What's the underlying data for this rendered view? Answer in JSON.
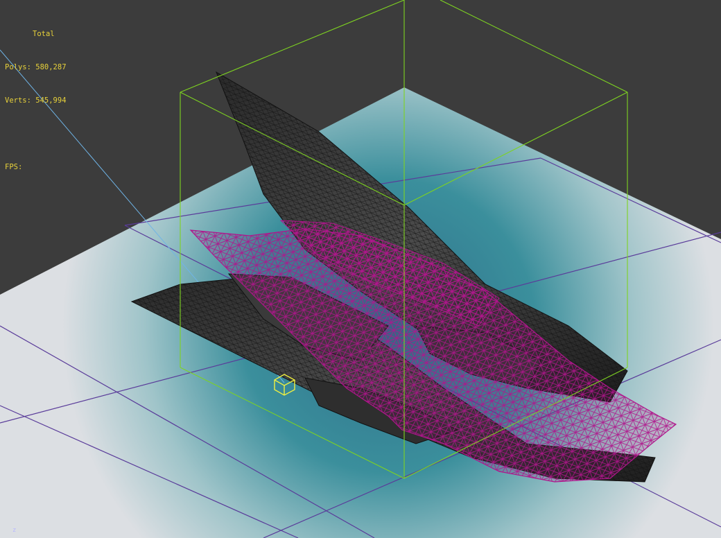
{
  "hud": {
    "total_label": "Total",
    "polys_label": "Polys:",
    "polys_value": "580,287",
    "verts_label": "Verts:",
    "verts_value": "545,994",
    "fps_label": "FPS:",
    "fps_value": ""
  },
  "viewport": {
    "axis_label": "z"
  },
  "colors": {
    "background": "#3c3c3c",
    "hud_text": "#e8d23a",
    "bounding_box": "#7ed321",
    "selection_wire": "#b0158c",
    "grid_lines": "#5a3c9a",
    "helper_line": "#6fb4e6",
    "light_gizmo": "#f0f040",
    "ground_center": "#2f7f92",
    "ground_edge": "#d6d9dd"
  },
  "icons": {
    "light_gizmo": "cube-light-icon"
  }
}
